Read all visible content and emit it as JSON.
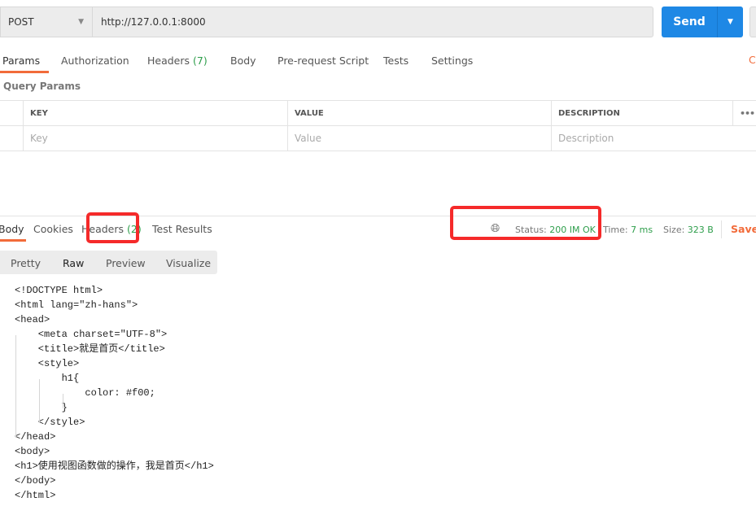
{
  "request": {
    "method": "POST",
    "url": "http://127.0.0.1:8000",
    "send_label": "Send"
  },
  "request_tabs": [
    {
      "label": "Params"
    },
    {
      "label": "Authorization"
    },
    {
      "label": "Headers",
      "count": "(7)"
    },
    {
      "label": "Body"
    },
    {
      "label": "Pre-request Script"
    },
    {
      "label": "Tests"
    },
    {
      "label": "Settings"
    }
  ],
  "cookies_label": "C",
  "query_params": {
    "title": "Query Params",
    "headers": [
      "KEY",
      "VALUE",
      "DESCRIPTION"
    ],
    "placeholders": [
      "Key",
      "Value",
      "Description"
    ],
    "more": "•••"
  },
  "response_tabs": [
    {
      "label": "Body"
    },
    {
      "label": "Cookies"
    },
    {
      "label": "Headers",
      "count": "(2)"
    },
    {
      "label": "Test Results"
    }
  ],
  "status": {
    "status_label": "Status:",
    "status_value": "200 IM OK",
    "time_label": "Time:",
    "time_value": "7 ms",
    "size_label": "Size:",
    "size_value": "323 B",
    "save_label": "Save R"
  },
  "view_modes": [
    "Pretty",
    "Raw",
    "Preview",
    "Visualize"
  ],
  "code_lines": [
    "<!DOCTYPE html>",
    "<html lang=\"zh-hans\">",
    "<head>",
    "    <meta charset=\"UTF-8\">",
    "    <title>就是首页</title>",
    "    <style>",
    "        h1{",
    "            color: #f00;",
    "        }",
    "    </style>",
    "</head>",
    "<body>",
    "<h1>使用视图函数做的操作，我是首页</h1>",
    "</body>",
    "</html>"
  ],
  "colors": {
    "accent": "#f26b3a",
    "send": "#1e88e5",
    "success": "#2e9e4b",
    "highlight": "#f52a2a"
  }
}
